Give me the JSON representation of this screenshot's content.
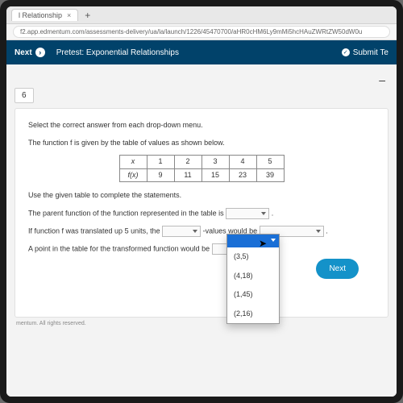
{
  "browser": {
    "tab_title": "l Relationship",
    "url": "f2.app.edmentum.com/assessments-delivery/ua/la/launch/1226/45470700/aHR0cHM6Ly9mMi5hcHAuZWRtZW50dW0u"
  },
  "header": {
    "next_label": "Next",
    "title": "Pretest: Exponential Relationships",
    "submit_label": "Submit Te"
  },
  "question": {
    "number": "6",
    "instruction": "Select the correct answer from each drop-down menu.",
    "intro": "The function f is given by the table of values as shown below.",
    "table": {
      "row1": [
        "x",
        "1",
        "2",
        "3",
        "4",
        "5"
      ],
      "row2": [
        "f(x)",
        "9",
        "11",
        "15",
        "23",
        "39"
      ]
    },
    "line1": "Use the given table to complete the statements.",
    "line2_a": "The parent function of the function represented in the table is ",
    "line2_b": ".",
    "line3_a": "If function f was translated up 5 units, the ",
    "line3_b": " -values would be ",
    "line3_c": ".",
    "line4_a": "A point in the table for the transformed function would be ",
    "line4_b": "."
  },
  "dropdown_open": {
    "options": [
      "(3,5)",
      "(4,18)",
      "(1,45)",
      "(2,16)"
    ]
  },
  "buttons": {
    "next": "Next"
  },
  "footer": "mentum. All rights reserved."
}
